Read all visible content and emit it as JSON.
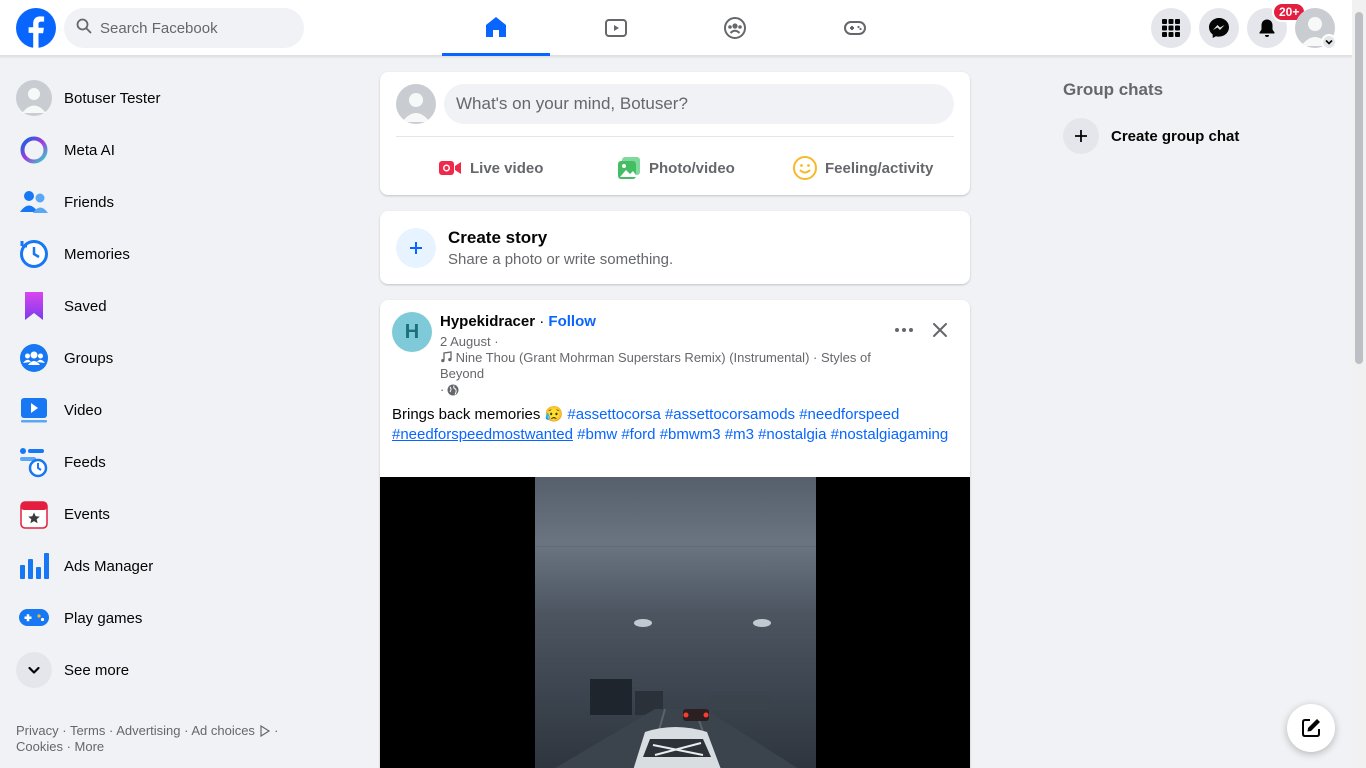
{
  "topbar": {
    "search_placeholder": "Search Facebook",
    "tabs": [
      {
        "name": "home",
        "icon": "home-icon",
        "active": true
      },
      {
        "name": "video",
        "icon": "video-icon",
        "active": false
      },
      {
        "name": "groups",
        "icon": "groups-icon",
        "active": false
      },
      {
        "name": "gaming",
        "icon": "gaming-icon",
        "active": false
      }
    ],
    "notification_badge": "20+"
  },
  "sidebar": {
    "items": [
      {
        "label": "Botuser Tester",
        "icon": "profile-avatar"
      },
      {
        "label": "Meta AI",
        "icon": "meta-ai-icon"
      },
      {
        "label": "Friends",
        "icon": "friends-icon"
      },
      {
        "label": "Memories",
        "icon": "memories-icon"
      },
      {
        "label": "Saved",
        "icon": "saved-icon"
      },
      {
        "label": "Groups",
        "icon": "groups-icon"
      },
      {
        "label": "Video",
        "icon": "video-icon"
      },
      {
        "label": "Feeds",
        "icon": "feeds-icon"
      },
      {
        "label": "Events",
        "icon": "events-icon"
      },
      {
        "label": "Ads Manager",
        "icon": "ads-manager-icon"
      },
      {
        "label": "Play games",
        "icon": "play-games-icon"
      },
      {
        "label": "See more",
        "icon": "chevron-down-icon"
      }
    ],
    "footer": {
      "privacy": "Privacy",
      "terms": "Terms",
      "advertising": "Advertising",
      "ad_choices": "Ad choices",
      "cookies": "Cookies",
      "more": "More"
    }
  },
  "composer": {
    "placeholder": "What's on your mind, Botuser?",
    "actions": {
      "live": "Live video",
      "photo": "Photo/video",
      "feeling": "Feeling/activity"
    }
  },
  "story": {
    "title": "Create story",
    "subtitle": "Share a photo or write something."
  },
  "post": {
    "avatar_letter": "H",
    "author": "Hypekidracer",
    "separator": "·",
    "follow": "Follow",
    "date": "2 August ·",
    "music": "Nine Thou (Grant Mohrman Superstars Remix) (Instrumental) · Styles of Beyond",
    "privacy_prefix": "·",
    "text": "Brings back memories 😥",
    "hashtags": [
      "#assettocorsa",
      "#assettocorsamods",
      "#needforspeed",
      "#needforspeedmostwanted",
      "#bmw",
      "#ford",
      "#bmwm3",
      "#m3",
      "#nostalgia",
      "#nostalgiagaming"
    ]
  },
  "right": {
    "group_chats_title": "Group chats",
    "create_group_chat": "Create group chat"
  },
  "colors": {
    "brand": "#0866ff",
    "badge": "#e41e3f",
    "background": "#f0f2f5"
  }
}
